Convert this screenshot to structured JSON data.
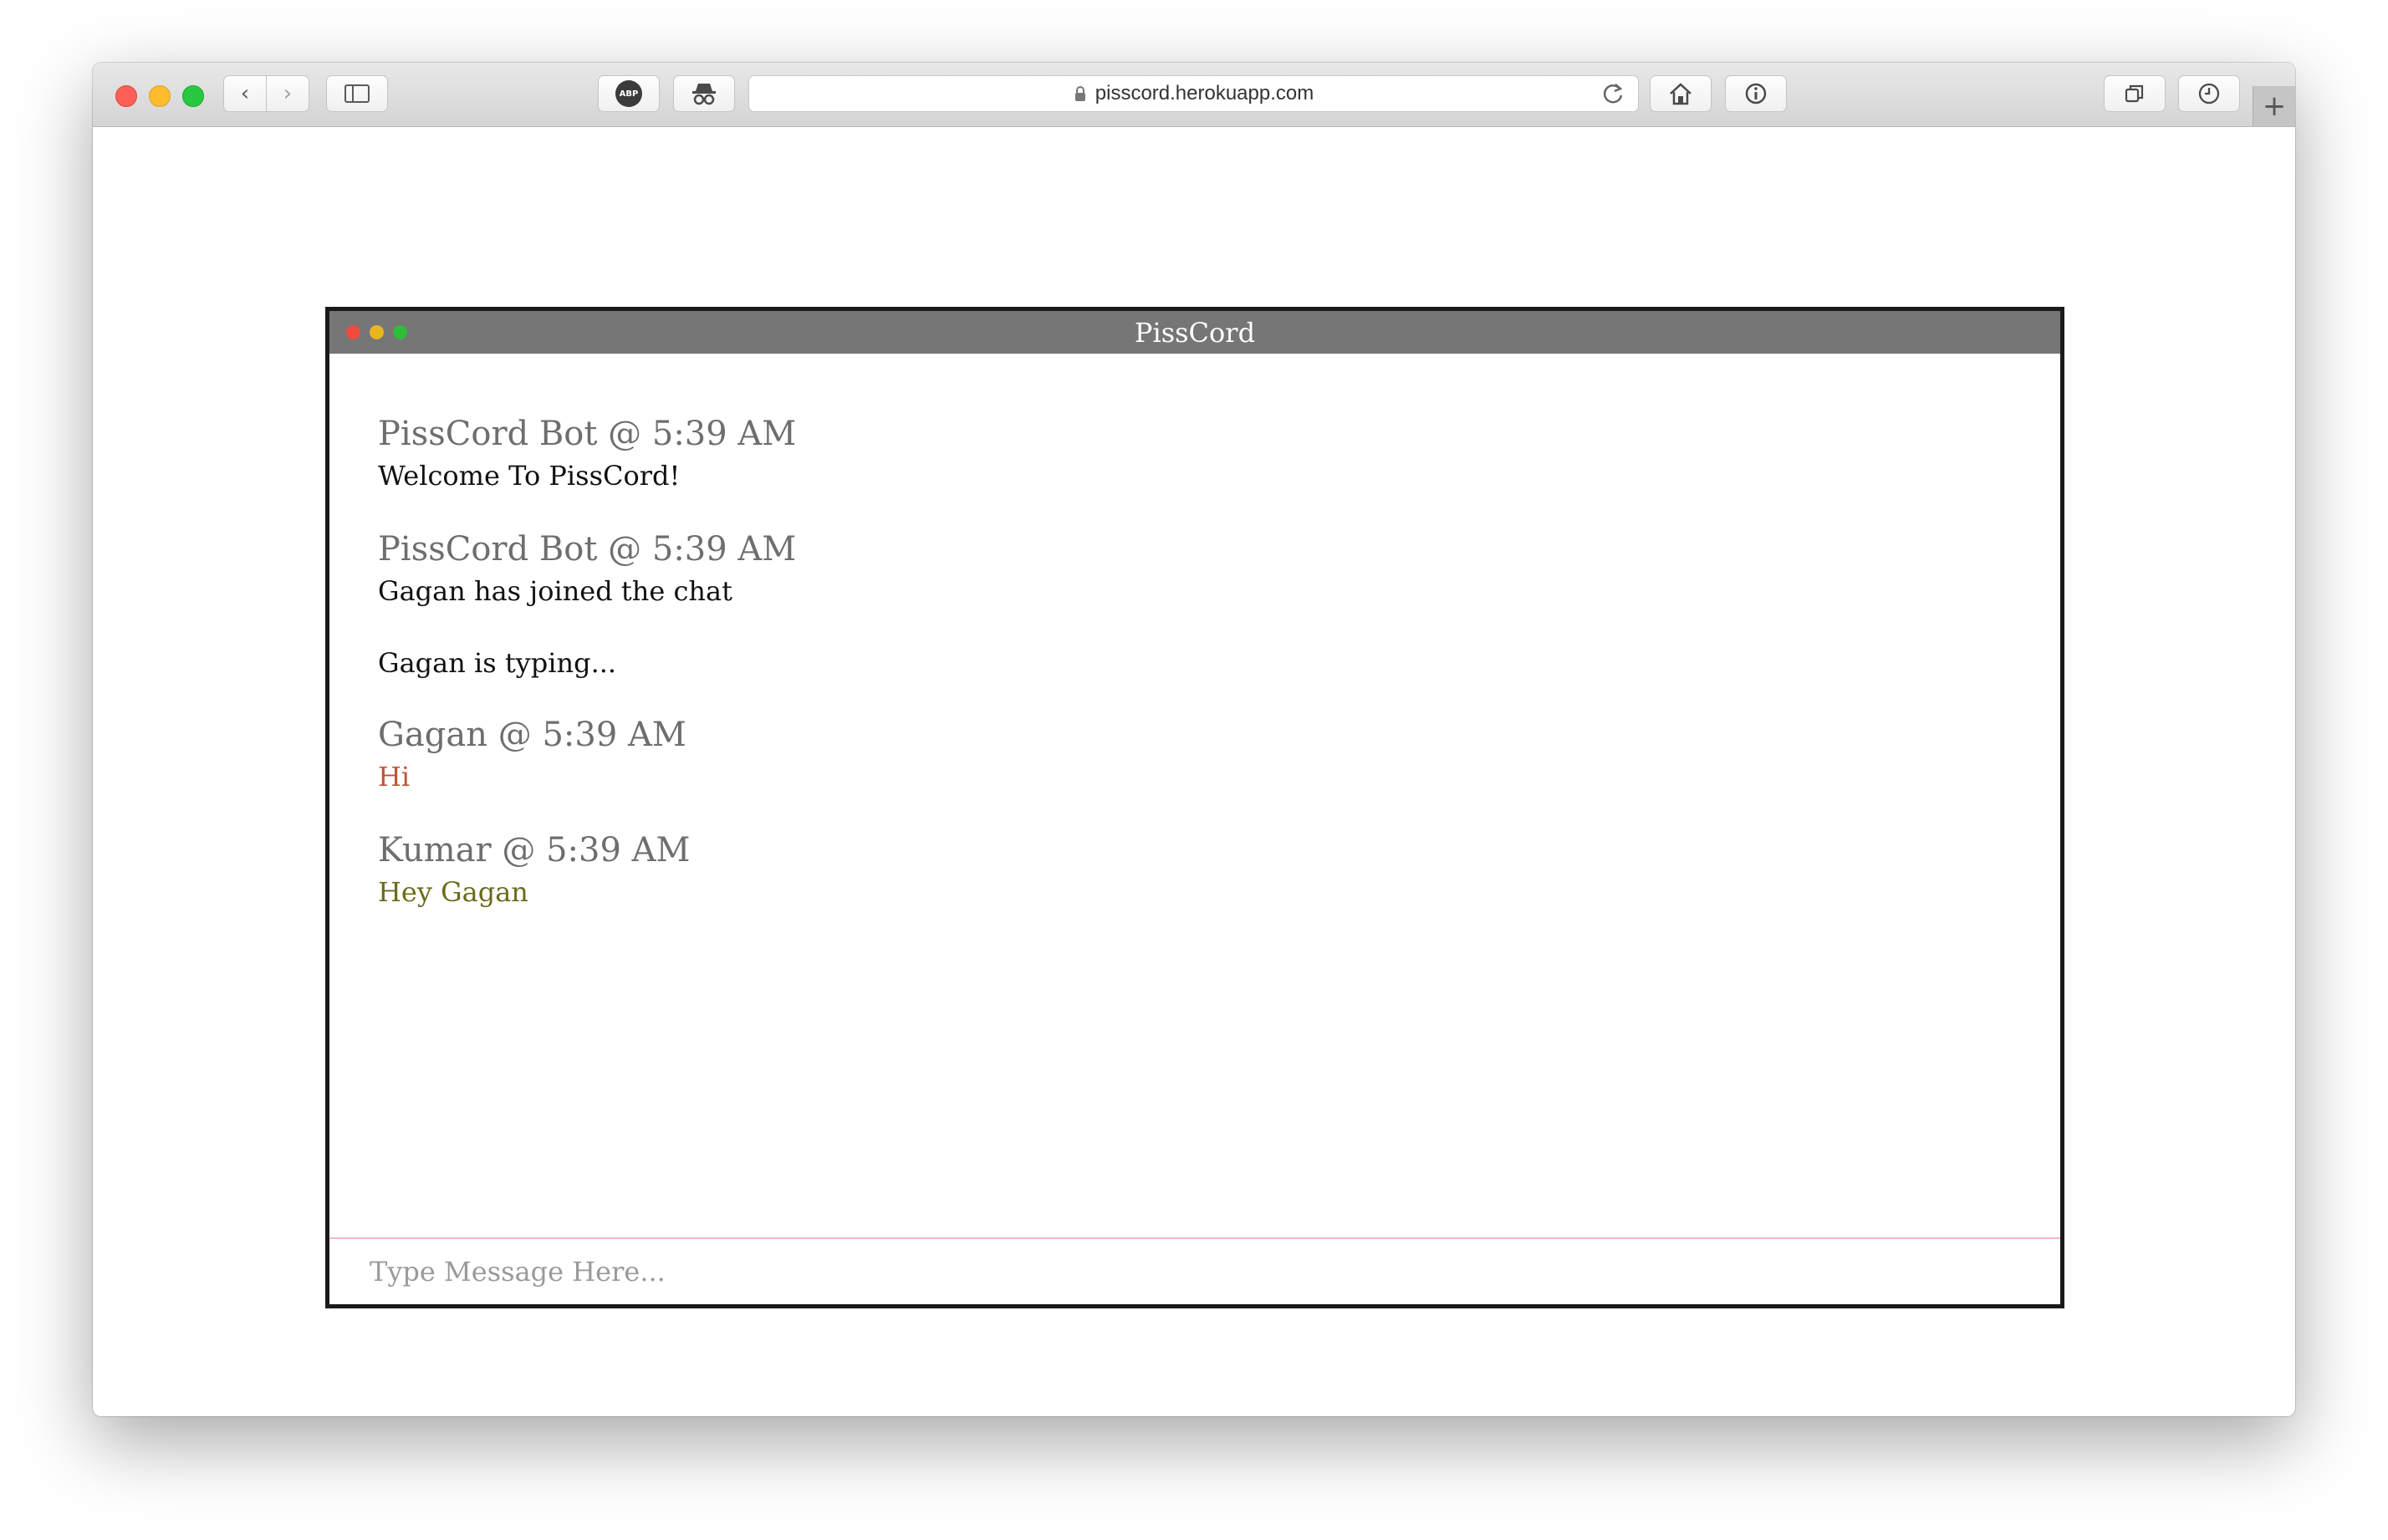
{
  "browser": {
    "url": "pisscord.herokuapp.com",
    "buttons": {
      "back": "‹",
      "forward": "›",
      "abp": "ABP",
      "new_tab": "+"
    }
  },
  "app": {
    "title": "PissCord",
    "messages": [
      {
        "header": "PissCord Bot @ 5:39 AM",
        "body": "Welcome To PissCord!",
        "color": "#111111"
      },
      {
        "header": "PissCord Bot @ 5:39 AM",
        "body": "Gagan has joined the chat",
        "color": "#111111"
      }
    ],
    "typing_indicator": "Gagan is typing...",
    "user_messages": [
      {
        "header": "Gagan @ 5:39 AM",
        "body": "Hi",
        "color": "#c0553a"
      },
      {
        "header": "Kumar @ 5:39 AM",
        "body": "Hey Gagan",
        "color": "#6b6b1a"
      }
    ],
    "input": {
      "placeholder": "Type Message Here...",
      "value": ""
    }
  }
}
